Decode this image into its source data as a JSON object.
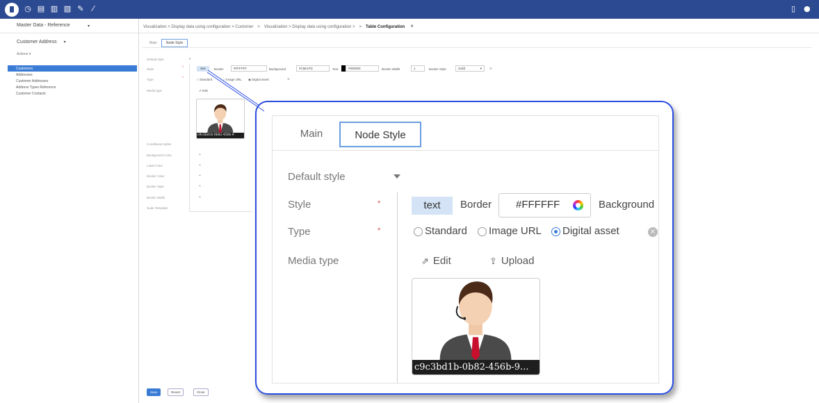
{
  "header": {
    "sidebar_title": "Master Data - Reference",
    "breadcrumb": [
      "Visualization > Display data using configuration > Customer",
      "Visualization > Display data using configuration >",
      "Table Configuration"
    ]
  },
  "sidebar": {
    "entity_title": "Customer Address",
    "actions_label": "Actions",
    "items": [
      {
        "label": "Customers",
        "active": true
      },
      {
        "label": "Addresses",
        "active": false
      },
      {
        "label": "Customer Addresses",
        "active": false
      },
      {
        "label": "Address Types Reference",
        "active": false
      },
      {
        "label": "Customer Contacts",
        "active": false
      }
    ]
  },
  "tabs": {
    "main": "Main",
    "node_style": "Node Style"
  },
  "form": {
    "default_style_label": "Default style",
    "style_label": "Style",
    "type_label": "Type",
    "media_type_label": "Media type",
    "style": {
      "text_chip": "text",
      "border_label": "Border",
      "border_value": "#FFFFFF",
      "background_label": "Background",
      "background_value": "#C5E1FD",
      "text_label": "Text",
      "text_value": "#000000",
      "border_width_label": "Border Width",
      "border_width_value": "1",
      "border_style_label": "Border Style",
      "border_style_value": "Solid"
    },
    "type_options": [
      "Standard",
      "Image URL",
      "Digital asset"
    ],
    "type_selected": "Digital asset",
    "edit_label": "Edit",
    "upload_label": "Upload",
    "media_caption": "c9c3bd1b-0b82-456b-9...",
    "media_caption_small": "c9c3bd1b-0b82-456b-9",
    "conditional_styles_label": "Conditional styles",
    "conditional_fields": [
      "Background Color",
      "Label Color",
      "Border Color",
      "Border Style",
      "Border Width"
    ],
    "node_template_label": "Node Template"
  },
  "buttons": {
    "save": "Save",
    "revert": "Revert",
    "close": "Close"
  },
  "colors": {
    "topbar": "#2c4a92",
    "accent": "#3a7bd5",
    "chip": "#d4e4f6",
    "callout_border": "#2a4de0",
    "required": "#d9534f"
  }
}
